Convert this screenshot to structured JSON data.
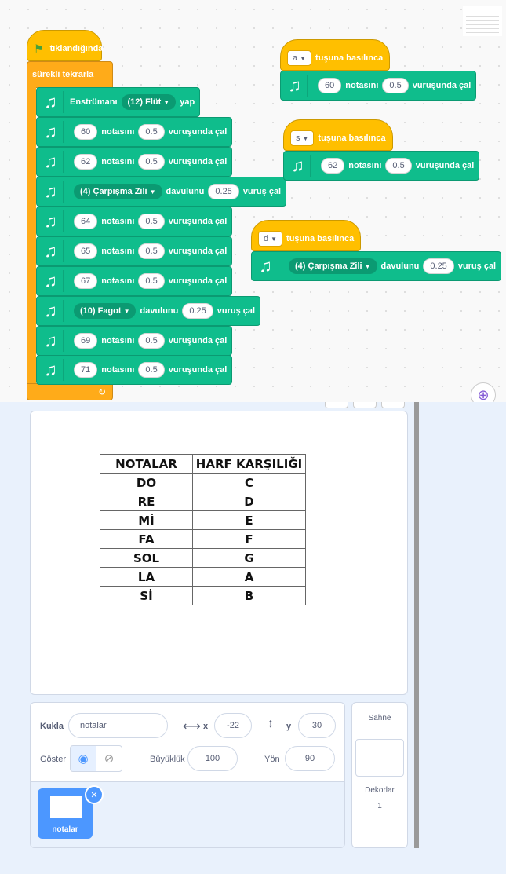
{
  "main_script": {
    "hat_label": "tıklandığında",
    "loop_label": "sürekli tekrarla",
    "instrument_block": {
      "prefix": "Enstrümanı",
      "value": "(12) Flüt",
      "suffix": "yap"
    },
    "blocks": [
      {
        "type": "note",
        "note": "60",
        "beats": "0.5"
      },
      {
        "type": "note",
        "note": "62",
        "beats": "0.5"
      },
      {
        "type": "drum",
        "drum": "(4) Çarpışma Zili",
        "beats": "0.25"
      },
      {
        "type": "note",
        "note": "64",
        "beats": "0.5"
      },
      {
        "type": "note",
        "note": "65",
        "beats": "0.5"
      },
      {
        "type": "note",
        "note": "67",
        "beats": "0.5"
      },
      {
        "type": "drum",
        "drum": "(10) Fagot",
        "beats": "0.25"
      },
      {
        "type": "note",
        "note": "69",
        "beats": "0.5"
      },
      {
        "type": "note",
        "note": "71",
        "beats": "0.5"
      }
    ],
    "note_label": "notasını",
    "note_suffix": "vuruşunda çal",
    "drum_label": "davulunu",
    "drum_suffix": "vuruş çal"
  },
  "key_scripts": [
    {
      "key": "a",
      "hat_label": "tuşuna basılınca",
      "type": "note",
      "note": "60",
      "beats": "0.5"
    },
    {
      "key": "s",
      "hat_label": "tuşuna basılınca",
      "type": "note",
      "note": "62",
      "beats": "0.5"
    },
    {
      "key": "d",
      "hat_label": "tuşuna basılınca",
      "type": "drum",
      "drum": "(4) Çarpışma Zili",
      "beats": "0.25"
    }
  ],
  "stage_table": {
    "headers": [
      "NOTALAR",
      "HARF KARŞILIĞI"
    ],
    "rows": [
      [
        "DO",
        "C"
      ],
      [
        "RE",
        "D"
      ],
      [
        "Mİ",
        "E"
      ],
      [
        "FA",
        "F"
      ],
      [
        "SOL",
        "G"
      ],
      [
        "LA",
        "A"
      ],
      [
        "Sİ",
        "B"
      ]
    ]
  },
  "sprite_info": {
    "sprite_label": "Kukla",
    "sprite_name": "notalar",
    "x_label": "x",
    "x_value": "-22",
    "y_label": "y",
    "y_value": "30",
    "show_label": "Göster",
    "size_label": "Büyüklük",
    "size_value": "100",
    "direction_label": "Yön",
    "direction_value": "90"
  },
  "sprite_tile": {
    "name": "notalar"
  },
  "stage_side": {
    "title": "Sahne",
    "backdrops_label": "Dekorlar",
    "backdrops_count": "1"
  },
  "colors": {
    "events": "#ffbf00",
    "control": "#ffab19",
    "music": "#0fbd8c",
    "accent": "#4c97ff"
  }
}
